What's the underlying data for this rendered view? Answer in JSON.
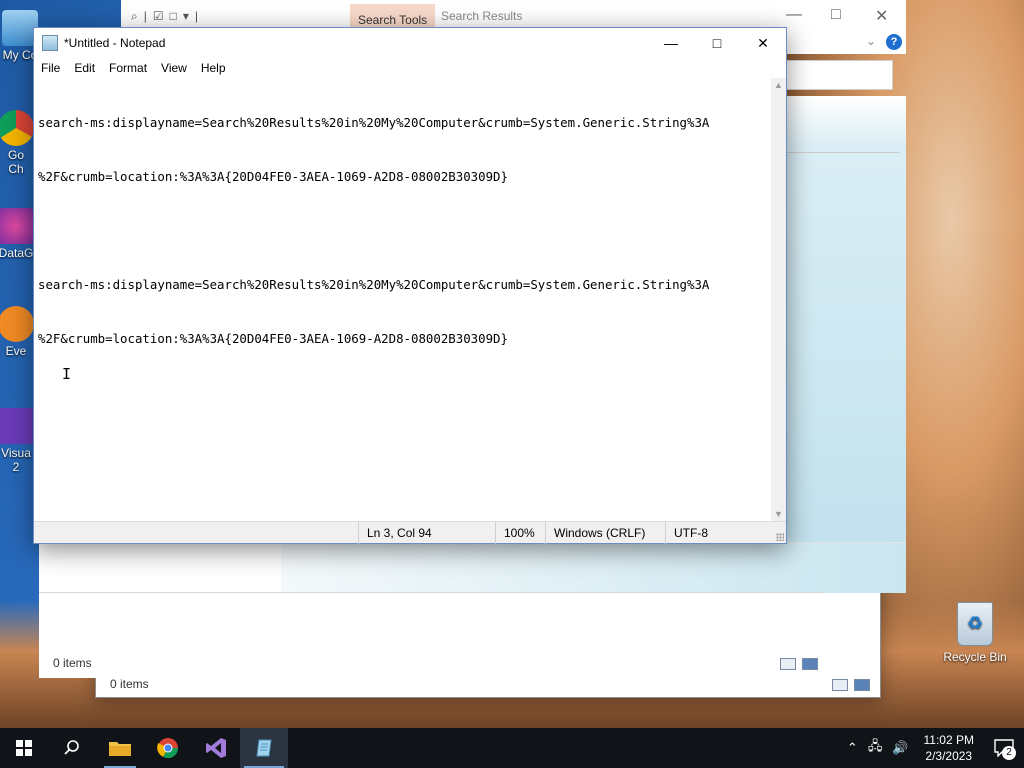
{
  "desktop": {
    "icons": [
      {
        "name": "my-computer",
        "label": "My Co"
      },
      {
        "name": "google-chrome",
        "label": "Go\nCh"
      },
      {
        "name": "datagrip",
        "label": "DataG"
      },
      {
        "name": "everything",
        "label": "Eve"
      },
      {
        "name": "visual-studio",
        "label": "Visua\n2"
      }
    ],
    "recycle_bin_label": "Recycle Bin"
  },
  "explorer_back": {
    "search_tools_tab": "Search Tools",
    "search_results_title": "Search Results",
    "status_items": "0 items"
  },
  "explorer_back2": {
    "status_items": "0 items"
  },
  "notepad": {
    "title": "*Untitled - Notepad",
    "menu": [
      "File",
      "Edit",
      "Format",
      "View",
      "Help"
    ],
    "lines": [
      "search-ms:displayname=Search%20Results%20in%20My%20Computer&crumb=System.Generic.String%3A",
      "%2F&crumb=location:%3A%3A{20D04FE0-3AEA-1069-A2D8-08002B30309D}",
      "",
      "search-ms:displayname=Search%20Results%20in%20My%20Computer&crumb=System.Generic.String%3A",
      "%2F&crumb=location:%3A%3A{20D04FE0-3AEA-1069-A2D8-08002B30309D}"
    ],
    "status": {
      "position": "Ln 3, Col 94",
      "zoom": "100%",
      "line_ending": "Windows (CRLF)",
      "encoding": "UTF-8"
    }
  },
  "taskbar": {
    "apps": [
      "file-explorer",
      "chrome",
      "visual-studio",
      "notepad"
    ],
    "time": "11:02 PM",
    "date": "2/3/2023",
    "notification_count": "2"
  }
}
